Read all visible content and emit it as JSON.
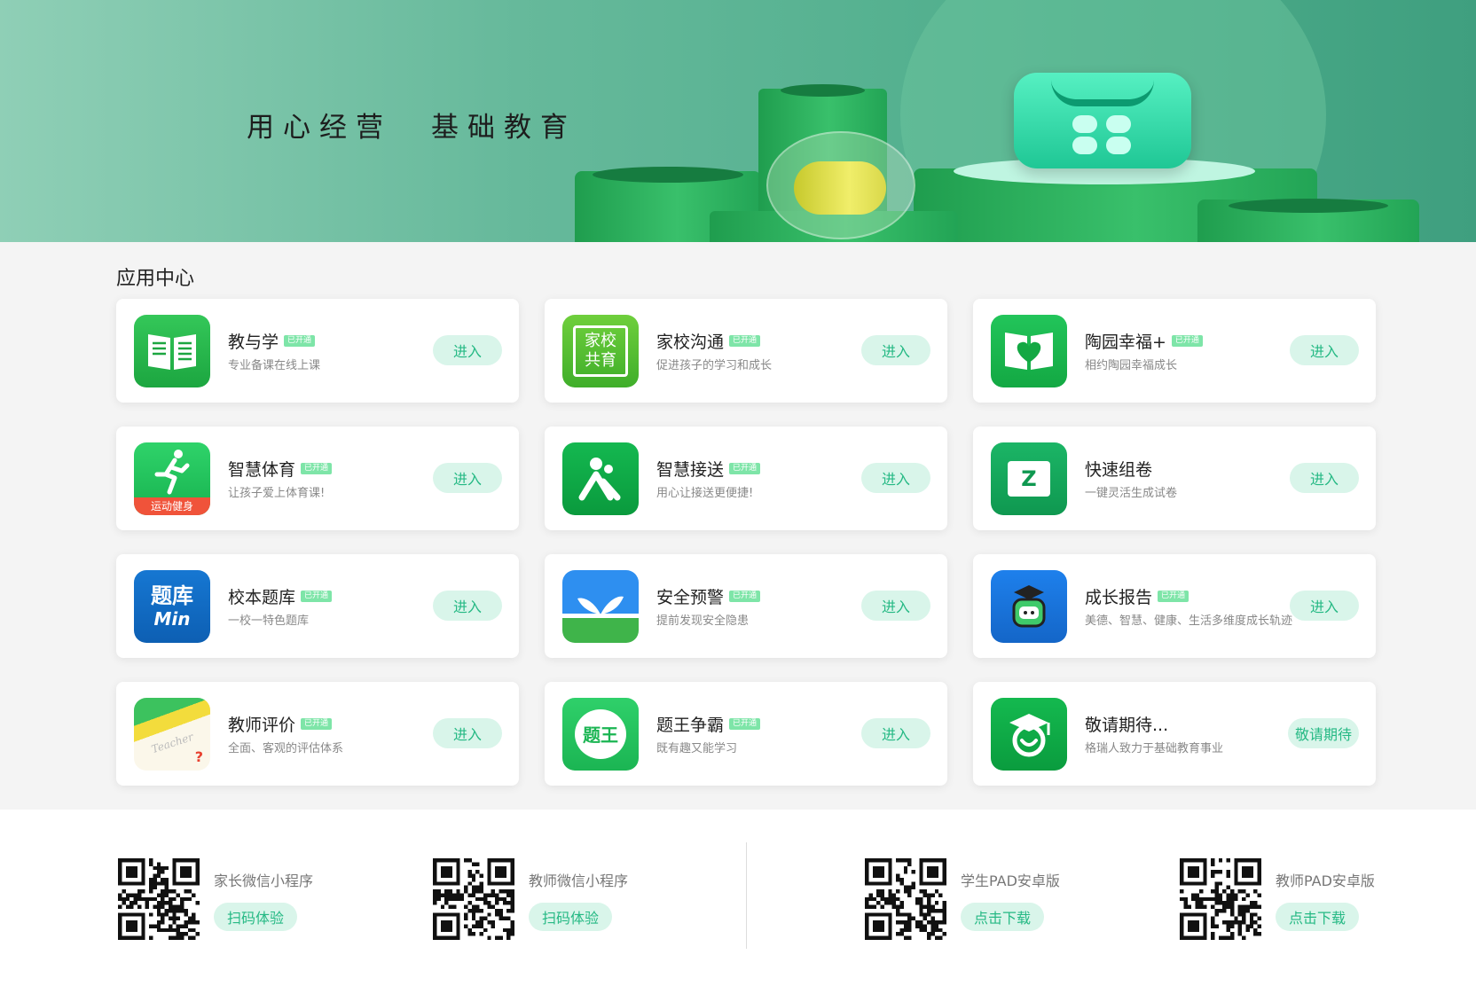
{
  "banner": {
    "slogan_left": "用心经营",
    "slogan_right": "基础教育"
  },
  "section": {
    "title": "应用中心"
  },
  "apps": [
    {
      "name": "教与学",
      "badge": "已开通",
      "desc": "专业备课在线上课",
      "button": "进入",
      "icon": "open-book-icon"
    },
    {
      "name": "家校沟通",
      "badge": "已开通",
      "desc": "促进孩子的学习和成长",
      "button": "进入",
      "icon": "home-school-icon",
      "icon_text_1": "家校",
      "icon_text_2": "共育"
    },
    {
      "name": "陶园幸福+",
      "badge": "已开通",
      "desc": "相约陶园幸福成长",
      "button": "进入",
      "icon": "heart-book-icon"
    },
    {
      "name": "智慧体育",
      "badge": "已开通",
      "desc": "让孩子爱上体育课!",
      "button": "进入",
      "icon": "running-man-icon",
      "icon_text_1": "运动健身"
    },
    {
      "name": "智慧接送",
      "badge": "已开通",
      "desc": "用心让接送更便捷!",
      "button": "进入",
      "icon": "pickup-people-icon"
    },
    {
      "name": "快速组卷",
      "badge": "",
      "desc": "一键灵活生成试卷",
      "button": "进入",
      "icon": "exam-paper-icon",
      "icon_text_1": "Z"
    },
    {
      "name": "校本题库",
      "badge": "已开通",
      "desc": "一校一特色题库",
      "button": "进入",
      "icon": "question-bank-icon",
      "icon_text_1": "题库",
      "icon_text_2": "Min"
    },
    {
      "name": "安全预警",
      "badge": "已开通",
      "desc": "提前发现安全隐患",
      "button": "进入",
      "icon": "sprout-icon"
    },
    {
      "name": "成长报告",
      "badge": "已开通",
      "desc": "美德、智慧、健康、生活多维度成长轨迹",
      "button": "进入",
      "icon": "graduate-robot-icon"
    },
    {
      "name": "教师评价",
      "badge": "已开通",
      "desc": "全面、客观的评估体系",
      "button": "进入",
      "icon": "teacher-note-icon",
      "icon_text_1": "Teacher"
    },
    {
      "name": "题王争霸",
      "badge": "已开通",
      "desc": "既有趣又能学习",
      "button": "进入",
      "icon": "apple-king-icon",
      "icon_text_1": "题王"
    },
    {
      "name": "敬请期待...",
      "badge": "",
      "desc": "格瑞人致力于基础教育事业",
      "button": "敬请期待",
      "icon": "graduation-cap-smile-icon"
    }
  ],
  "footer": [
    {
      "label": "家长微信小程序",
      "button": "扫码体验"
    },
    {
      "label": "教师微信小程序",
      "button": "扫码体验"
    },
    {
      "label": "学生PAD安卓版",
      "button": "点击下载"
    },
    {
      "label": "教师PAD安卓版",
      "button": "点击下载"
    }
  ],
  "colors": {
    "primary": "#25b984",
    "button_bg": "#d9f5ea",
    "badge": "#7ee5a8",
    "banner": "#5fb596"
  }
}
